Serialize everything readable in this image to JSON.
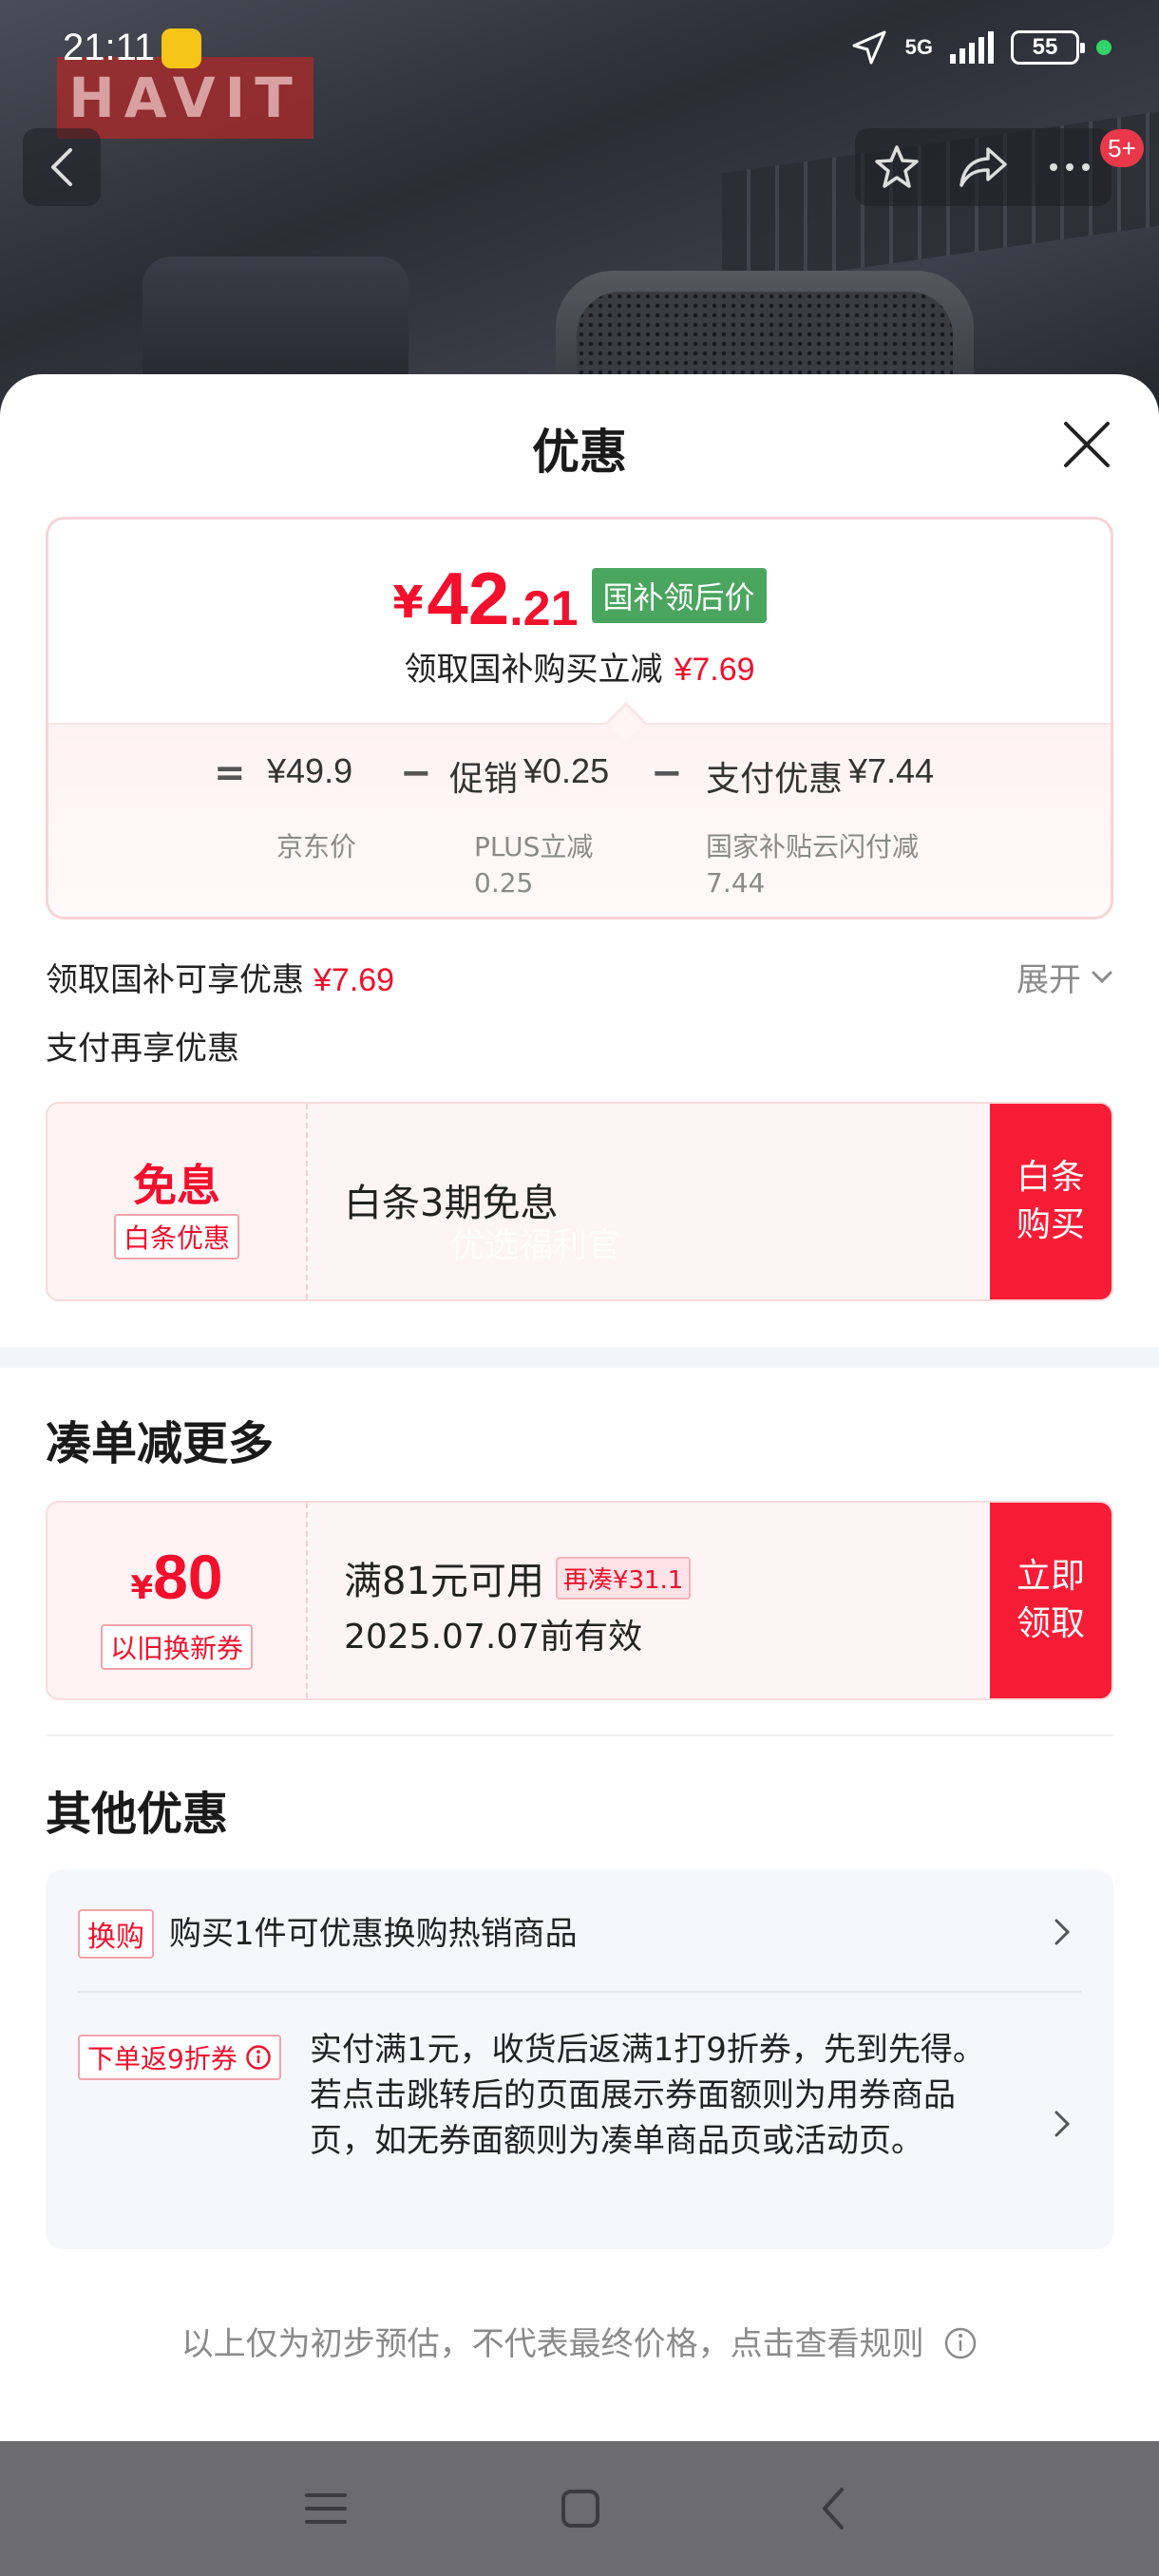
{
  "status_bar": {
    "time": "21:11",
    "network": "5G",
    "battery": "55"
  },
  "background": {
    "brand": "HAVIT"
  },
  "top_actions": {
    "message_badge": "5+"
  },
  "sheet": {
    "title": "优惠"
  },
  "price_card": {
    "currency": "¥",
    "price_integer": "42",
    "price_decimal": ".21",
    "price_tag": "国补领后价",
    "subtitle": "领取国补购买立减",
    "subtitle_amount": "¥7.69",
    "formula": {
      "equals": "=",
      "jd_price": "¥49.9",
      "minus1": "−",
      "promo_label": "促销",
      "promo_value": "¥0.25",
      "minus2": "−",
      "pay_label": "支付优惠",
      "pay_value": "¥7.44"
    },
    "formula_labels": {
      "jd_price": "京东价",
      "plus_line1": "PLUS立减",
      "plus_line2": "0.25",
      "subsidy_line1": "国家补贴云闪付减",
      "subsidy_line2": "7.44"
    }
  },
  "subsidy_row": {
    "label": "领取国补可享优惠",
    "amount": "¥7.69",
    "expand": "展开"
  },
  "pay_row": {
    "label": "支付再享优惠"
  },
  "baitiao_coupon": {
    "title": "免息",
    "tag": "白条优惠",
    "desc": "白条3期免息",
    "watermark": "优选福利官",
    "button": "白条购买"
  },
  "section_more": {
    "title": "凑单减更多"
  },
  "trade_in_coupon": {
    "currency": "¥",
    "amount": "80",
    "tag": "以旧换新券",
    "condition": "满81元可用",
    "extra_tag": "再凑¥31.1",
    "validity": "2025.07.07前有效",
    "button": "立即领取"
  },
  "section_other": {
    "title": "其他优惠"
  },
  "other_offers": [
    {
      "tag": "换购",
      "text": "购买1件可优惠换购热销商品"
    },
    {
      "tag": "下单返9折券",
      "text": "实付满1元，收货后返满1打9折券，先到先得。若点击跳转后的页面展示券面额则为用券商品页，如无券面额则为凑单商品页或活动页。"
    }
  ],
  "disclaimer": "以上仅为初步预估，不代表最终价格，点击查看规则",
  "colors": {
    "accent_red": "#f2102d",
    "button_red": "#f71c36",
    "tag_green": "#4aa55e"
  }
}
